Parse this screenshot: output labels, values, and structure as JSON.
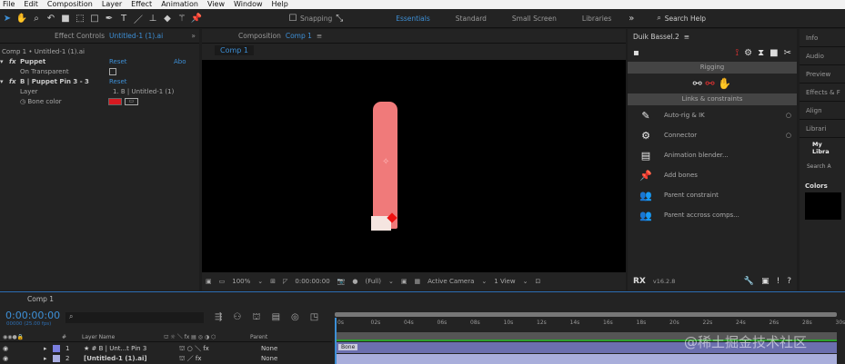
{
  "menu": [
    "File",
    "Edit",
    "Composition",
    "Layer",
    "Effect",
    "Animation",
    "View",
    "Window",
    "Help"
  ],
  "toolbar": {
    "snapping": "Snapping",
    "workspaces": [
      "Essentials",
      "Standard",
      "Small Screen",
      "Libraries"
    ],
    "search": "Search Help"
  },
  "effect_controls": {
    "title": "Effect Controls",
    "layer": "Untitled-1 (1).ai",
    "breadcrumb": "Comp 1 • Untitled-1 (1).ai",
    "puppet": "Puppet",
    "reset": "Reset",
    "about": "Abo",
    "on_transparent": "On Transparent",
    "pin": "B | Puppet Pin 3 - 3",
    "layer_label": "Layer",
    "layer_value": "1. B | Untitled-1 (1)",
    "bone_color_label": "Bone color",
    "bone_color": "#d71920"
  },
  "composition": {
    "title": "Composition",
    "name": "Comp 1",
    "tab": "Comp 1",
    "zoom": "100%",
    "time": "0:00:00:00",
    "quality": "(Full)",
    "camera": "Active Camera",
    "view": "1 View",
    "figure_color": "#f07a7a"
  },
  "duik": {
    "title": "Duik Bassel.2",
    "section1": "Rigging",
    "section2": "Links & constraints",
    "items": [
      "Auto-rig & IK",
      "Connector",
      "Animation blender...",
      "Add bones",
      "Parent constraint",
      "Parent accross comps..."
    ],
    "version": "v16.2.8"
  },
  "right_panel": {
    "tabs": [
      "Info",
      "Audio",
      "Preview",
      "Effects & F",
      "Align"
    ],
    "libraries": "Librari",
    "my_libra": "My Libra",
    "search": "Search A",
    "colors": "Colors"
  },
  "timeline": {
    "comp": "Comp 1",
    "timecode": "0:00:00:00",
    "fps": "00000 (25.00 fps)",
    "col_layer": "Layer Name",
    "col_num": "#",
    "col_parent": "Parent",
    "layers": [
      {
        "num": "1",
        "name": "B | Unt...t Pin 3",
        "parent": "None",
        "color": "#7b7fe0"
      },
      {
        "num": "2",
        "name": "[Untitled-1 (1).ai]",
        "parent": "None",
        "color": "#a9aee0"
      }
    ],
    "ticks": [
      "0s",
      "02s",
      "04s",
      "06s",
      "08s",
      "10s",
      "12s",
      "14s",
      "16s",
      "18s",
      "20s",
      "22s",
      "24s",
      "26s",
      "28s",
      "30s"
    ],
    "bar_label": "Bone",
    "watermark": "@稀土掘金技术社区"
  }
}
